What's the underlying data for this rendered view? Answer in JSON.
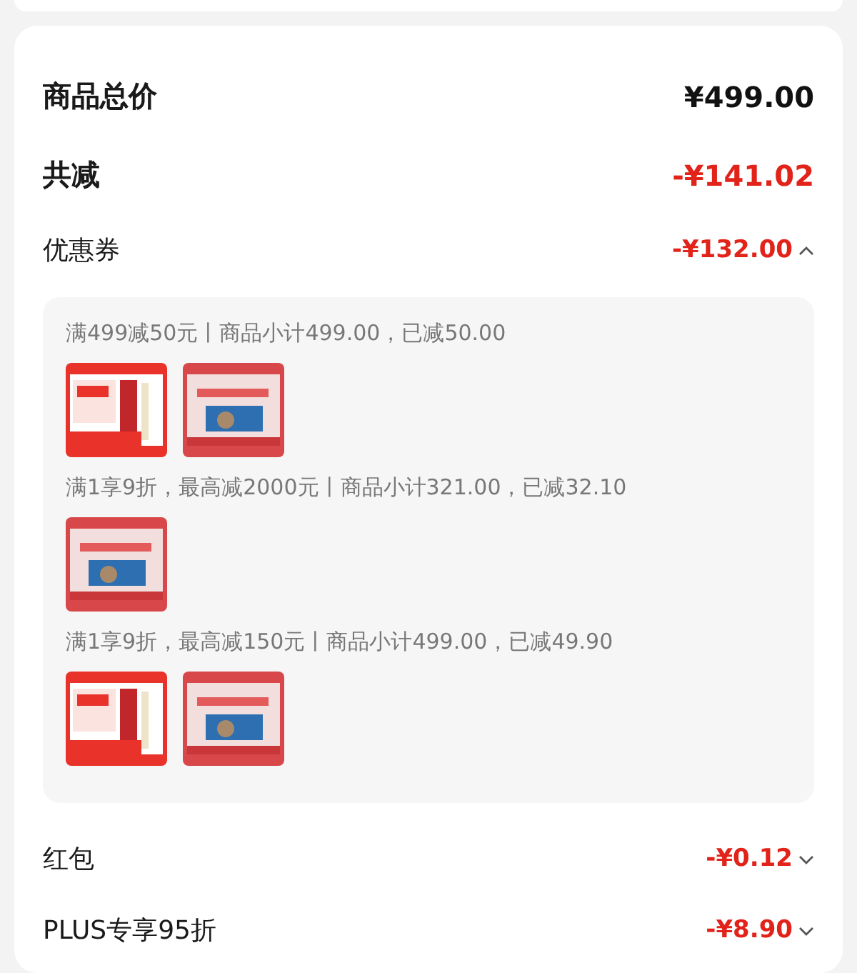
{
  "summary": [
    {
      "label": "商品总价",
      "amount": "¥499.00",
      "kind": "total"
    },
    {
      "label": "共减",
      "amount": "-¥141.02",
      "kind": "discount"
    }
  ],
  "details": [
    {
      "label": "优惠券",
      "amount": "-¥132.00",
      "expanded": true,
      "groups": [
        {
          "text": "满499减50元丨商品小计499.00，已减50.00"
        },
        {
          "text": "满1享9折，最高减2000元丨商品小计321.00，已减32.10"
        },
        {
          "text": "满1享9折，最高减150元丨商品小计499.00，已减49.90"
        }
      ]
    },
    {
      "label": "红包",
      "amount": "-¥0.12",
      "expanded": false
    },
    {
      "label": "PLUS专享95折",
      "amount": "-¥8.90",
      "expanded": false
    }
  ]
}
